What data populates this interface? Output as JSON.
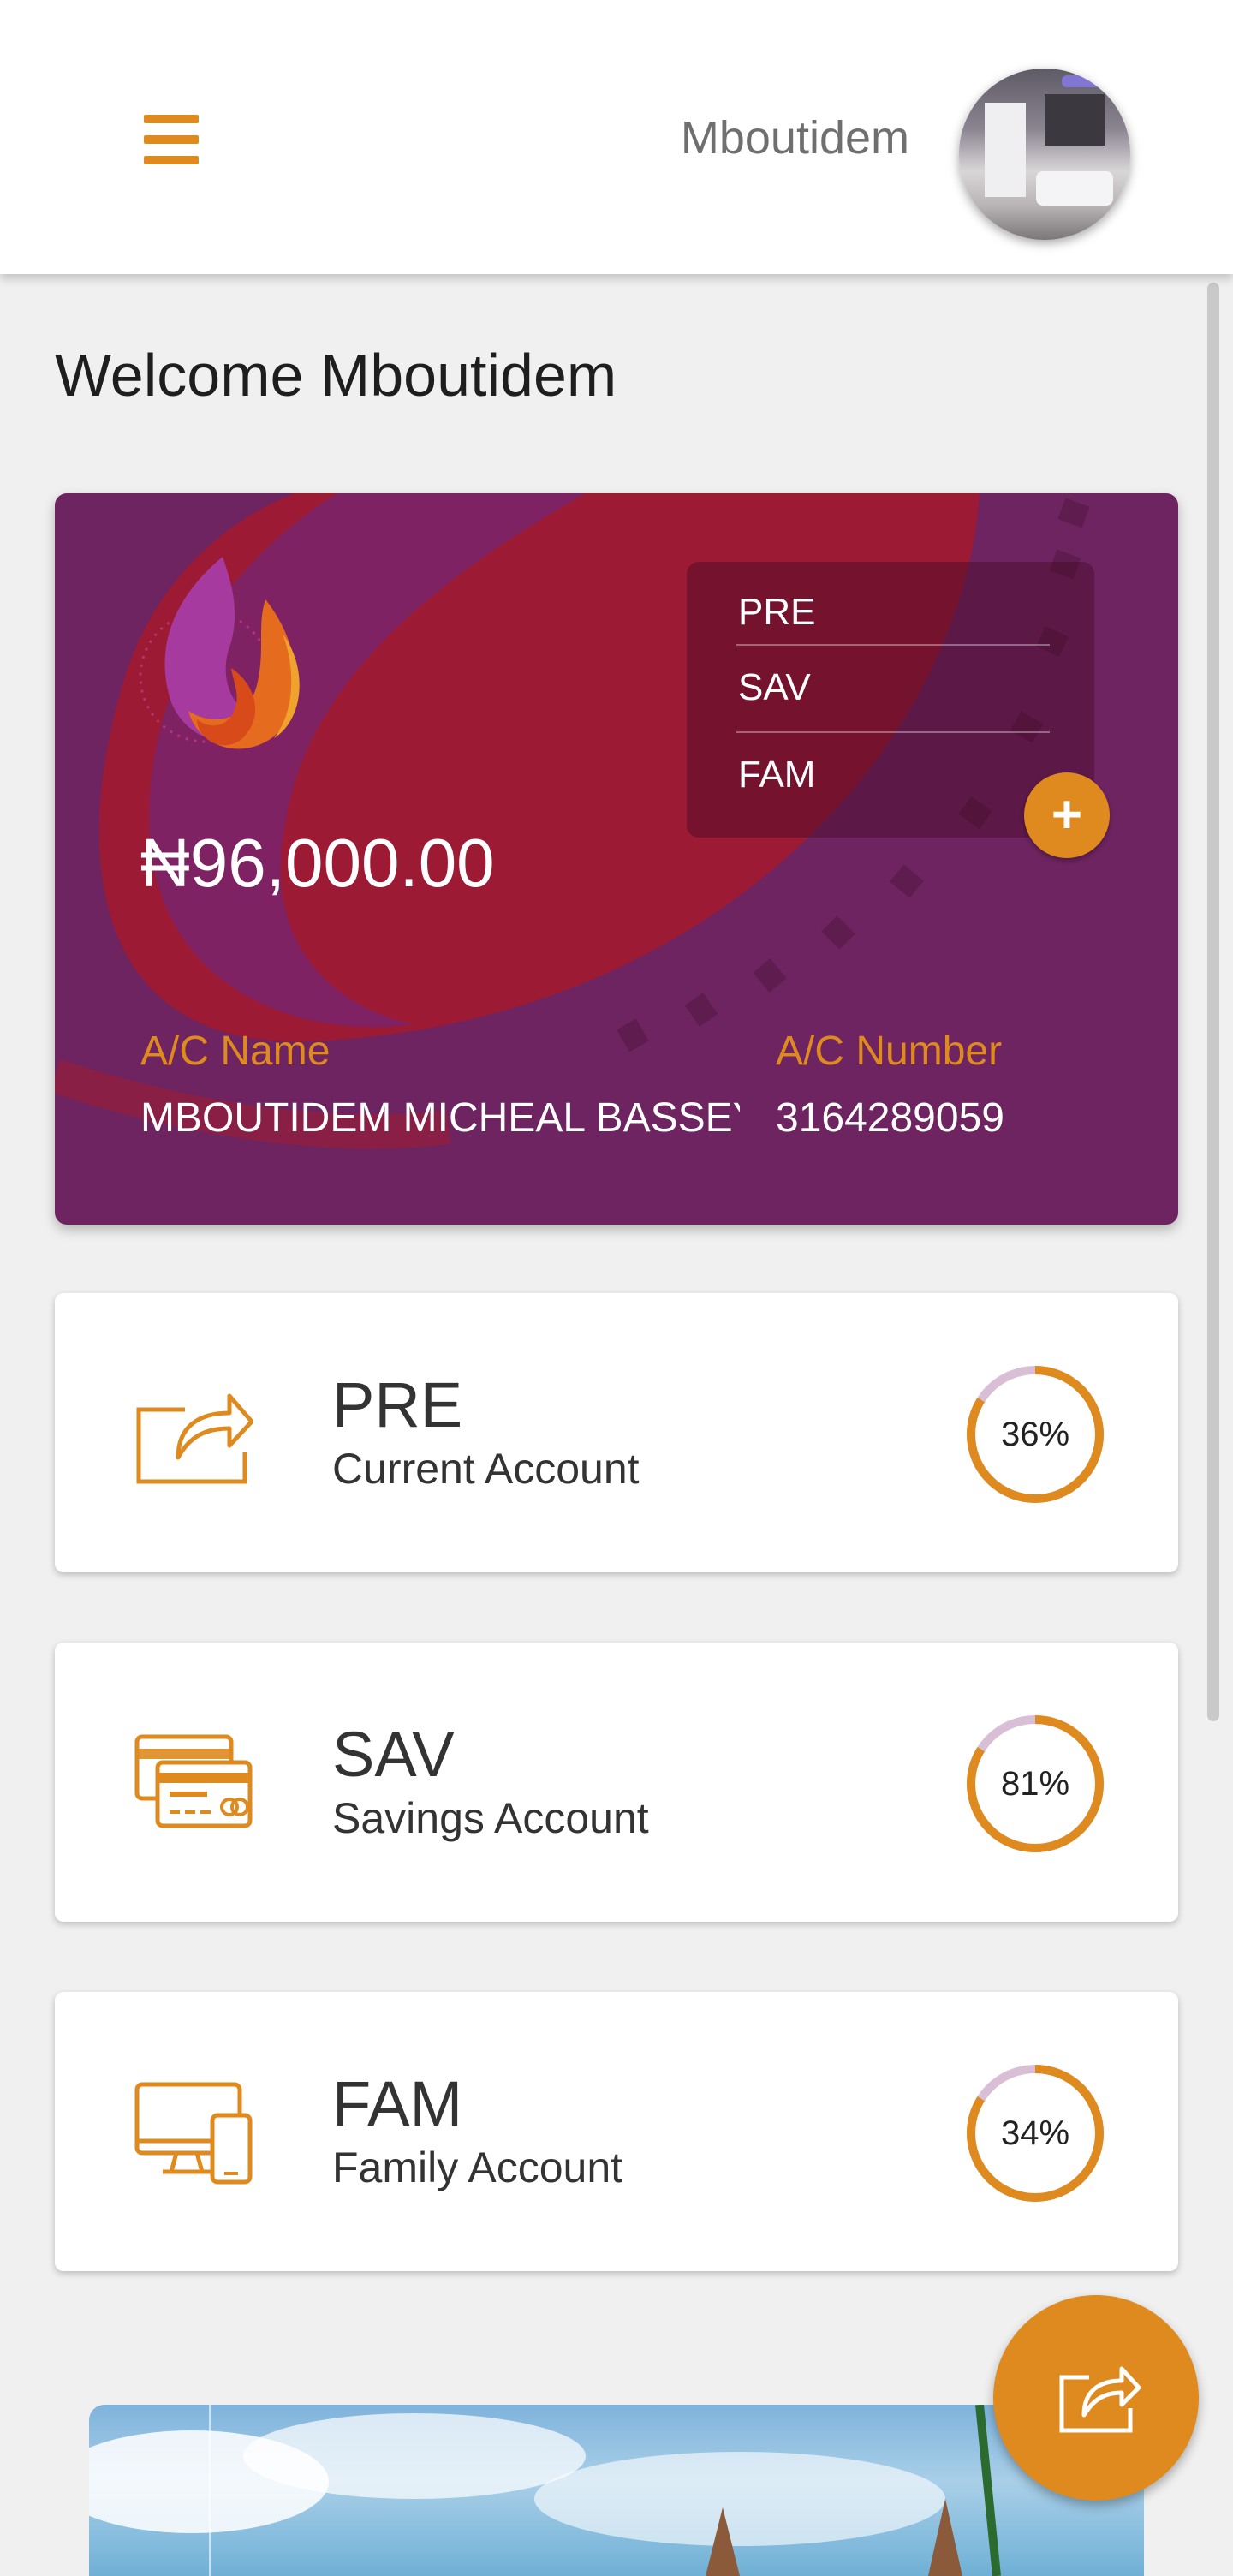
{
  "header": {
    "username": "Mboutidem"
  },
  "welcome": "Welcome Mboutidem",
  "card": {
    "balance": "₦96,000.00",
    "accounts": [
      "PRE",
      "SAV",
      "FAM"
    ],
    "ac_name_label": "A/C Name",
    "ac_name": "MBOUTIDEM MICHEAL BASSEY",
    "ac_number_label": "A/C Number",
    "ac_number": "3164289059"
  },
  "accounts": [
    {
      "code": "PRE",
      "desc": "Current Account",
      "percent_label": "36%",
      "percent": 36,
      "icon": "share-icon"
    },
    {
      "code": "SAV",
      "desc": "Savings Account",
      "percent_label": "81%",
      "percent": 81,
      "icon": "credit-card-icon"
    },
    {
      "code": "FAM",
      "desc": "Family Account",
      "percent_label": "34%",
      "percent": 34,
      "icon": "devices-icon"
    }
  ],
  "colors": {
    "accent": "#de8a1e",
    "card_bg": "#6e2460",
    "ring_track": "#d9bfd6"
  }
}
